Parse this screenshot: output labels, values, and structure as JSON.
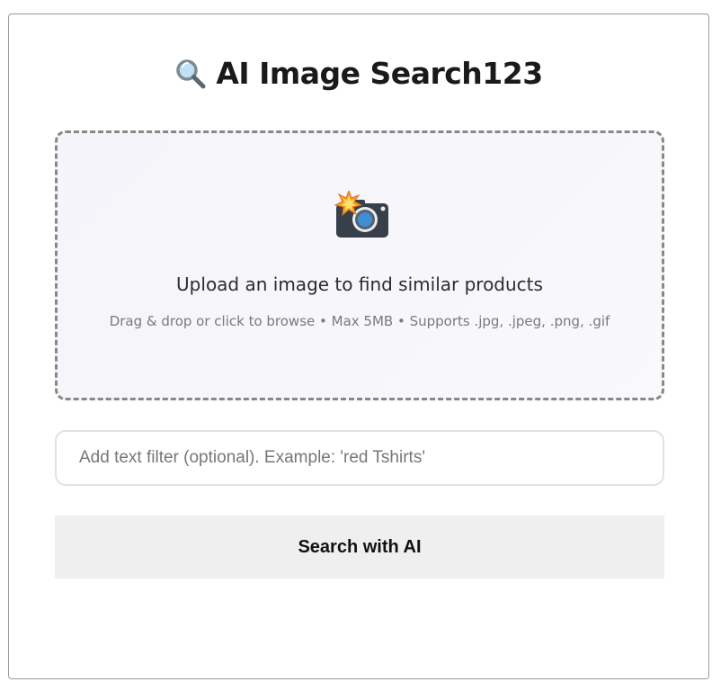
{
  "header": {
    "icon": "magnifying-glass-icon",
    "title": "AI Image Search123"
  },
  "upload": {
    "icon": "camera-flash-icon",
    "title": "Upload an image to find similar products",
    "subtitle": "Drag & drop or click to browse • Max 5MB • Supports .jpg, .jpeg, .png, .gif"
  },
  "filter": {
    "placeholder": "Add text filter (optional). Example: 'red Tshirts'",
    "value": ""
  },
  "search_button": {
    "label": "Search with AI"
  },
  "colors": {
    "dropzone_border": "#888888",
    "dropzone_bg": "#f5f5fa",
    "button_bg": "#efefef",
    "text_dark": "#1a1a1a"
  }
}
